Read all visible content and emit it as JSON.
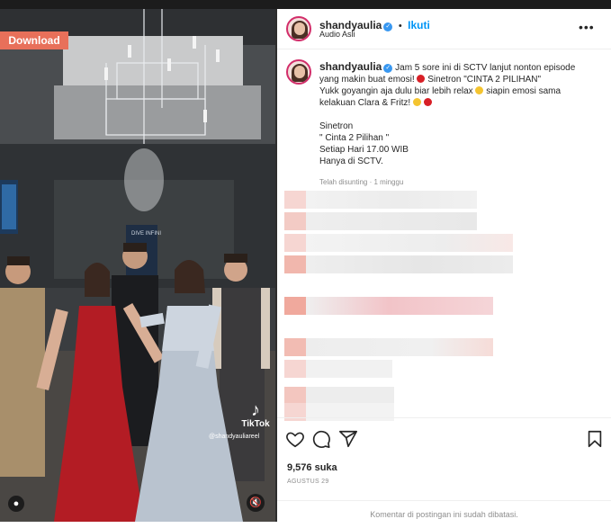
{
  "media": {
    "download_label": "Download",
    "tiktok_label": "TikTok",
    "watermark": "@shandyauliareel",
    "user_tag_icon": "person-icon",
    "mute_icon": "speaker-muted-icon",
    "sign_text": "DIVE INFINI"
  },
  "header": {
    "username": "shandyaulia",
    "separator": "•",
    "follow_label": "Ikuti",
    "audio_label": "Audio Asli"
  },
  "caption": {
    "username": "shandyaulia",
    "line1_a": "Jam 5 sore ini di SCTV lanjut nonton episode",
    "line2_a": "yang makin buat emosi!",
    "line2_b": "Sinetron \"CINTA 2 PILIHAN\"",
    "line3_a": "Yukk goyangin aja dulu biar lebih relax",
    "line3_b": "siapin emosi sama",
    "line4_a": "kelakuan Clara & Fritz!",
    "block_title": "Sinetron",
    "block_show": "\" Cinta 2 Pilihan \"",
    "block_schedule": "Setiap Hari 17.00 WIB",
    "block_channel": "Hanya di SCTV.",
    "edited_label": "Telah disunting · 1 minggu"
  },
  "actions": {
    "like_icon": "heart-icon",
    "comment_icon": "comment-icon",
    "share_icon": "share-icon",
    "save_icon": "bookmark-icon",
    "likes_label": "9,576 suka",
    "date_label": "AGUSTUS 29"
  },
  "footer": {
    "comments_disabled": "Komentar di postingan ini sudah dibatasi."
  },
  "colors": {
    "download_bg": "#e8705a",
    "link_blue": "#0095f6",
    "verified_blue": "#3897f0",
    "text": "#262626",
    "muted": "#8e8e8e"
  }
}
